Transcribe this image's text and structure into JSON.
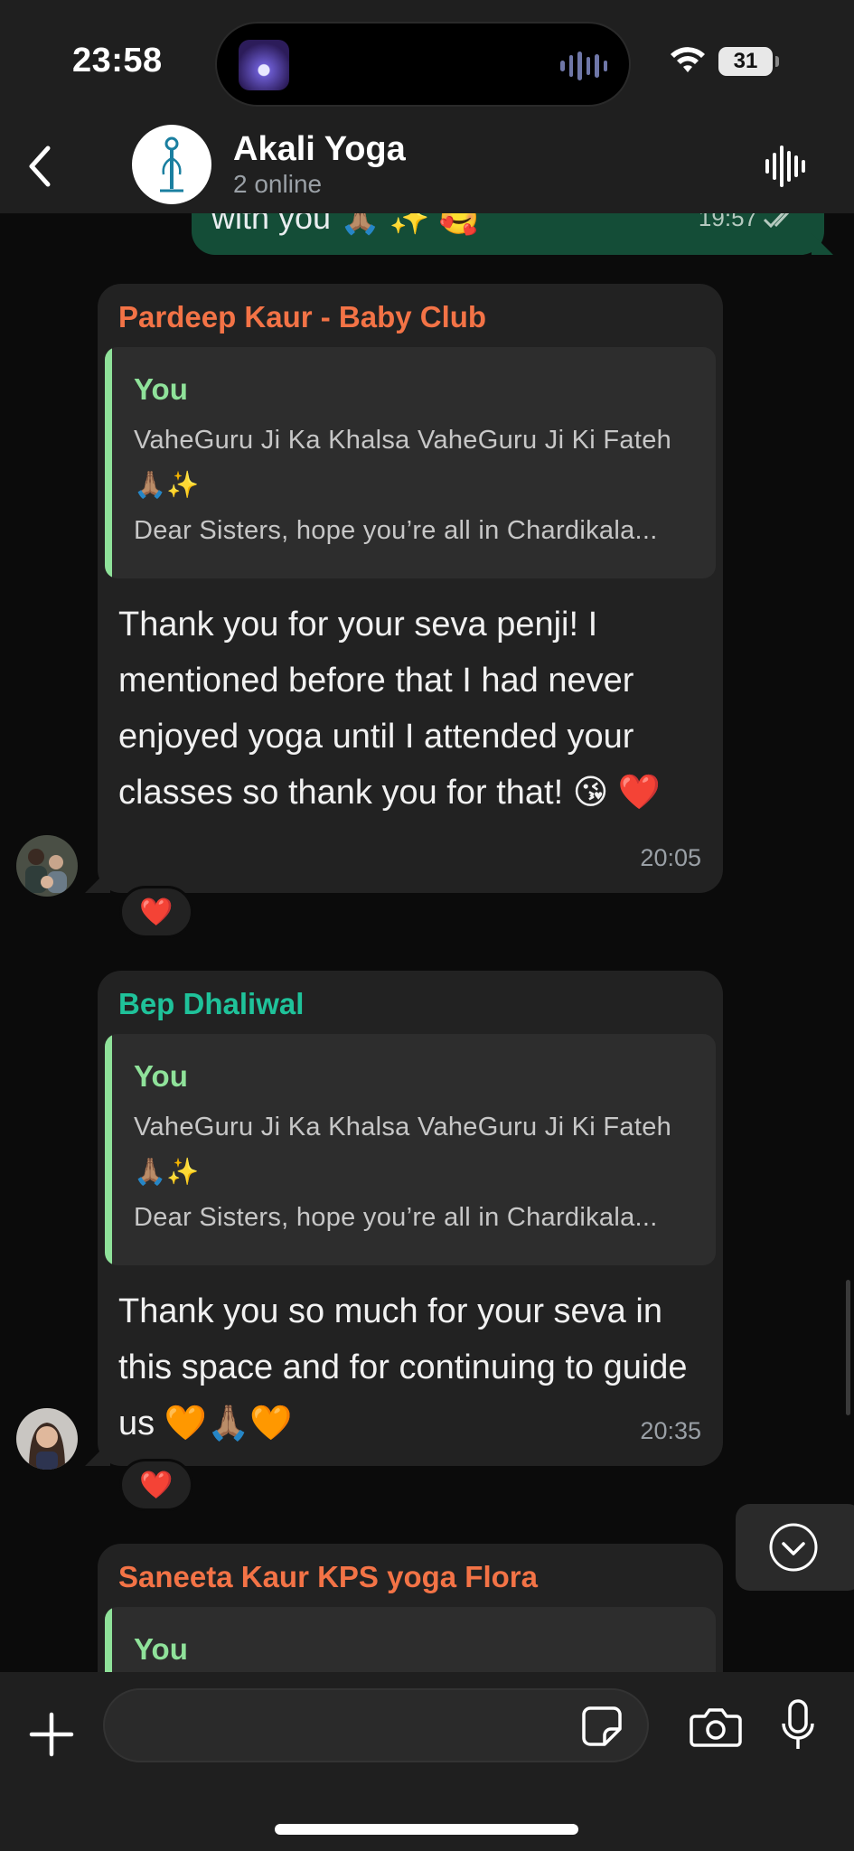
{
  "status_bar": {
    "time": "23:58",
    "battery": "31"
  },
  "header": {
    "title": "Akali Yoga",
    "subtitle": "2 online",
    "icons": {
      "back": "chevron-left-icon",
      "call": "voice-waveform-icon"
    }
  },
  "messages": {
    "outgoing_partial": {
      "text": "with you 🙏🏽 ✨ 🥰",
      "time": "19:57"
    },
    "items": [
      {
        "sender": "Pardeep Kaur - Baby Club",
        "sender_color": "#f37346",
        "quote_author": "You",
        "quote_line1": "VaheGuru Ji Ka Khalsa VaheGuru Ji Ki Fateh 🙏🏽✨",
        "quote_line2": "Dear Sisters, hope you’re all in Chardikala...",
        "text": "Thank you for your seva penji! I mentioned before that I had never enjoyed yoga until I attended your classes so thank you for that! 😘 ❤️",
        "time": "20:05",
        "reaction": "❤️"
      },
      {
        "sender": "Bep Dhaliwal",
        "sender_color": "#1fc29a",
        "quote_author": "You",
        "quote_line1": "VaheGuru Ji Ka Khalsa VaheGuru Ji Ki Fateh 🙏🏽✨",
        "quote_line2": "Dear Sisters, hope you’re all in Chardikala...",
        "text": "Thank you so much for your seva in this space and for continuing to guide us 🧡🙏🏽🧡",
        "time": "20:35",
        "reaction": "❤️"
      },
      {
        "sender": "Saneeta Kaur KPS yoga Flora",
        "sender_color": "#f37346",
        "quote_author": "You"
      }
    ]
  },
  "composer": {
    "placeholder": "",
    "icons": [
      "plus-icon",
      "sticker-icon",
      "camera-icon",
      "microphone-icon"
    ]
  },
  "colors": {
    "outgoing_bubble": "#144d37",
    "incoming_bubble": "#222222",
    "quote_accent": "#8fe29a",
    "background": "#0b0b0b"
  }
}
